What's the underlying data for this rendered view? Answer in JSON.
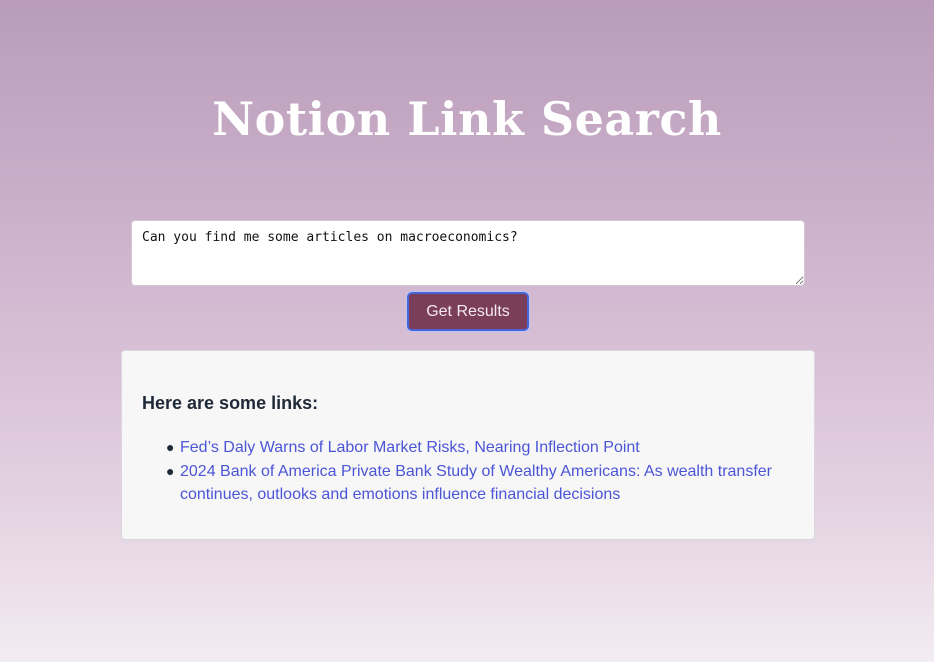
{
  "header": {
    "title": "Notion Link Search"
  },
  "search": {
    "value": "Can you find me some articles on macroeconomics?",
    "button_label": "Get Results"
  },
  "results": {
    "heading": "Here are some links:",
    "links": [
      {
        "label": "Fed’s Daly Warns of Labor Market Risks, Nearing Inflection Point"
      },
      {
        "label": "2024 Bank of America Private Bank Study of Wealthy Americans: As wealth transfer continues, outlooks and emotions influence financial decisions"
      }
    ]
  },
  "colors": {
    "button_bg": "#7a3d5a",
    "link": "#4b55d6",
    "button_focus_ring": "#4a64d8"
  }
}
